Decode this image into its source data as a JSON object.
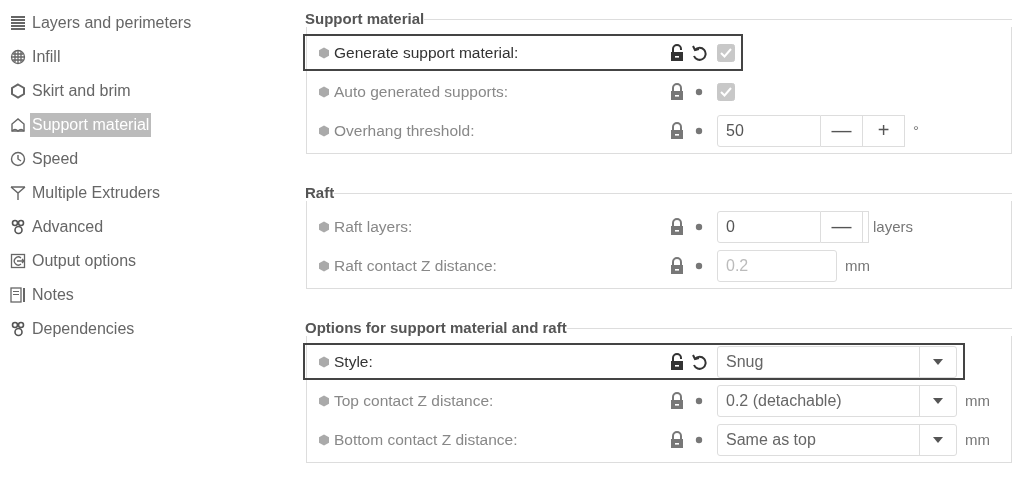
{
  "sidebar": {
    "items": [
      {
        "label": "Layers and perimeters",
        "selected": false
      },
      {
        "label": "Infill",
        "selected": false
      },
      {
        "label": "Skirt and brim",
        "selected": false
      },
      {
        "label": "Support material",
        "selected": true
      },
      {
        "label": "Speed",
        "selected": false
      },
      {
        "label": "Multiple Extruders",
        "selected": false
      },
      {
        "label": "Advanced",
        "selected": false
      },
      {
        "label": "Output options",
        "selected": false
      },
      {
        "label": "Notes",
        "selected": false
      },
      {
        "label": "Dependencies",
        "selected": false
      }
    ]
  },
  "sections": [
    {
      "title": "Support material",
      "rows": [
        {
          "kind": "checkbox",
          "label": "Generate support material:",
          "modified": true,
          "checked": true
        },
        {
          "kind": "checkbox",
          "label": "Auto generated supports:",
          "modified": false,
          "checked": true
        },
        {
          "kind": "spin",
          "label": "Overhang threshold:",
          "modified": false,
          "value": "50",
          "minus": "—",
          "plus": "+",
          "unit": "°"
        }
      ]
    },
    {
      "title": "Raft",
      "rows": [
        {
          "kind": "spin_cut",
          "label": "Raft layers:",
          "modified": false,
          "value": "0",
          "minus": "—",
          "unit": "layers"
        },
        {
          "kind": "number",
          "label": "Raft contact Z distance:",
          "modified": false,
          "value": "0.2",
          "disabled": true,
          "unit": "mm"
        }
      ]
    },
    {
      "title": "Options for support material and raft",
      "rows": [
        {
          "kind": "select",
          "label": "Style:",
          "modified": true,
          "value": "Snug"
        },
        {
          "kind": "select",
          "label": "Top contact Z distance:",
          "modified": false,
          "value": "0.2 (detachable)",
          "unit": "mm"
        },
        {
          "kind": "select",
          "label": "Bottom contact Z distance:",
          "modified": false,
          "value": "Same as top",
          "unit": "mm"
        }
      ]
    }
  ]
}
